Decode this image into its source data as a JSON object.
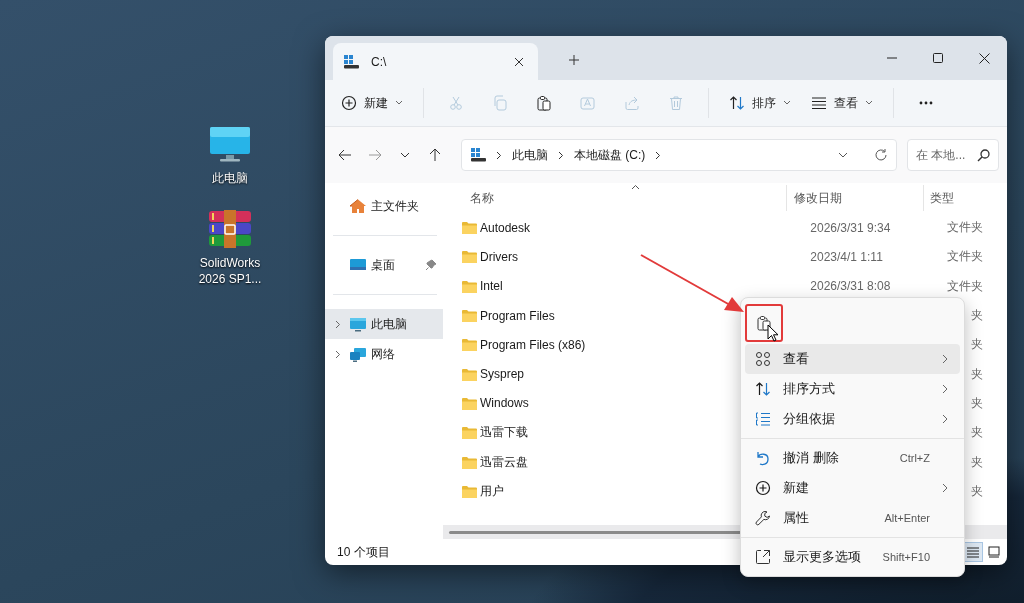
{
  "desktop": {
    "icons": [
      {
        "kind": "pc",
        "label": "此电脑"
      },
      {
        "kind": "archive",
        "label": "SolidWorks 2026 SP1..."
      }
    ]
  },
  "window": {
    "tab": {
      "title": "C:\\"
    },
    "toolbar": {
      "items": [
        {
          "kind": "new",
          "label": "新建",
          "dropdown": true,
          "disabled": false
        },
        {
          "kind": "cut",
          "disabled": true
        },
        {
          "kind": "copy",
          "disabled": true
        },
        {
          "kind": "paste",
          "disabled": false
        },
        {
          "kind": "rename",
          "disabled": true
        },
        {
          "kind": "share",
          "disabled": true
        },
        {
          "kind": "delete",
          "disabled": true
        },
        {
          "kind": "sort",
          "label": "排序",
          "dropdown": true,
          "disabled": false
        },
        {
          "kind": "view",
          "label": "查看",
          "dropdown": true,
          "disabled": false
        },
        {
          "kind": "more",
          "disabled": false
        }
      ]
    },
    "address": {
      "crumbs": [
        "此电脑",
        "本地磁盘 (C:)"
      ],
      "search_placeholder": "在 本地..."
    },
    "navigation": {
      "items": [
        {
          "kind": "home",
          "label": "主文件夹",
          "selected": false,
          "expandable": false,
          "pinned": false
        },
        {
          "kind": "desktop",
          "label": "桌面",
          "selected": false,
          "expandable": false,
          "pinned": true
        },
        {
          "kind": "pc",
          "label": "此电脑",
          "selected": true,
          "expandable": true,
          "pinned": false
        },
        {
          "kind": "network",
          "label": "网络",
          "selected": false,
          "expandable": true,
          "pinned": false
        }
      ]
    },
    "table": {
      "columns": [
        "名称",
        "修改日期",
        "类型"
      ],
      "rows": [
        {
          "name": "Autodesk",
          "modified": "2026/3/31 9:34",
          "type": "文件夹"
        },
        {
          "name": "Drivers",
          "modified": "2023/4/1 1:11",
          "type": "文件夹"
        },
        {
          "name": "Intel",
          "modified": "2026/3/31 8:08",
          "type": "文件夹"
        },
        {
          "name": "Program Files",
          "type": "夹"
        },
        {
          "name": "Program Files (x86)",
          "type": "夹"
        },
        {
          "name": "Sysprep",
          "type": "夹"
        },
        {
          "name": "Windows",
          "type": "夹"
        },
        {
          "name": "迅雷下载",
          "type": "夹"
        },
        {
          "name": "迅雷云盘",
          "type": "夹"
        },
        {
          "name": "用户",
          "type": "夹"
        }
      ]
    },
    "status_bar": {
      "count": "10 个项目",
      "view_buttons": [
        {
          "kind": "details",
          "selected": true
        },
        {
          "kind": "tiles",
          "selected": false
        }
      ]
    }
  },
  "context_menu": {
    "quick_actions": [
      {
        "kind": "paste",
        "annotated": true
      }
    ],
    "items": [
      {
        "kind": "view",
        "label": "查看",
        "submenu": true,
        "selected": true
      },
      {
        "kind": "sort",
        "label": "排序方式",
        "submenu": true,
        "selected": false
      },
      {
        "kind": "group",
        "label": "分组依据",
        "submenu": true,
        "selected": false
      },
      {
        "kind": "separator"
      },
      {
        "kind": "undo",
        "label": "撤消 删除",
        "shortcut": "Ctrl+Z",
        "submenu": false,
        "selected": false
      },
      {
        "kind": "new",
        "label": "新建",
        "submenu": true,
        "selected": false
      },
      {
        "kind": "properties",
        "label": "属性",
        "shortcut": "Alt+Enter",
        "submenu": false,
        "selected": false
      },
      {
        "kind": "separator"
      },
      {
        "kind": "more",
        "label": "显示更多选项",
        "shortcut": "Shift+F10",
        "submenu": false,
        "selected": false
      }
    ]
  }
}
